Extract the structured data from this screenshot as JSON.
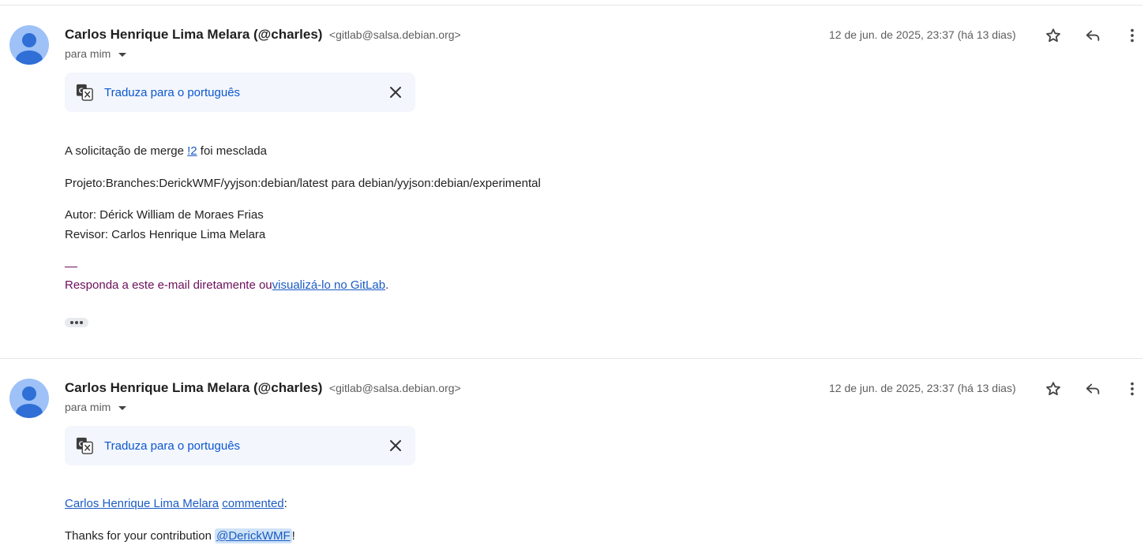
{
  "messages": [
    {
      "sender_name": "Carlos Henrique Lima Melara (@charles)",
      "sender_email": "<gitlab@salsa.debian.org>",
      "recipient": "para mim",
      "date": "12 de jun. de 2025, 23:37 (há 13 dias)",
      "translate_label": "Traduza para o português",
      "body": {
        "merged_prefix": "A solicitação de merge ",
        "merged_link": "!2",
        "merged_suffix": " foi mesclada",
        "project_line": "Projeto:Branches:DerickWMF/yyjson:debian/latest para debian/yyjson:debian/experimental",
        "author_line": "Autor: Dérick William de Moraes Frias",
        "reviewer_line": "Revisor: Carlos Henrique Lima Melara",
        "reply_prefix": "Responda a este e-mail diretamente ou",
        "reply_link": "visualizá-lo no GitLab",
        "reply_suffix": "."
      }
    },
    {
      "sender_name": "Carlos Henrique Lima Melara (@charles)",
      "sender_email": "<gitlab@salsa.debian.org>",
      "recipient": "para mim",
      "date": "12 de jun. de 2025, 23:37 (há 13 dias)",
      "translate_label": "Traduza para o português",
      "body": {
        "commenter_link": "Carlos Henrique Lima Melara",
        "commented_link": "commented",
        "commented_suffix": ":",
        "thanks_prefix": "Thanks for your contribution ",
        "mention": "@DerickWMF",
        "thanks_suffix": "!"
      }
    }
  ],
  "icons": {
    "avatar": "person-avatar-icon",
    "star": "star-icon",
    "reply": "reply-icon",
    "more": "more-vert-icon",
    "translate": "translate-icon",
    "close": "close-icon",
    "caret": "caret-down-icon",
    "ellipsis": "show-trimmed-content-icon"
  },
  "colors": {
    "link": "#1a5bc4",
    "translate_link": "#0b57d0",
    "signature": "#6b0f5b",
    "translate_bg": "#f3f6fc",
    "avatar_bg": "#9ec1f7"
  }
}
